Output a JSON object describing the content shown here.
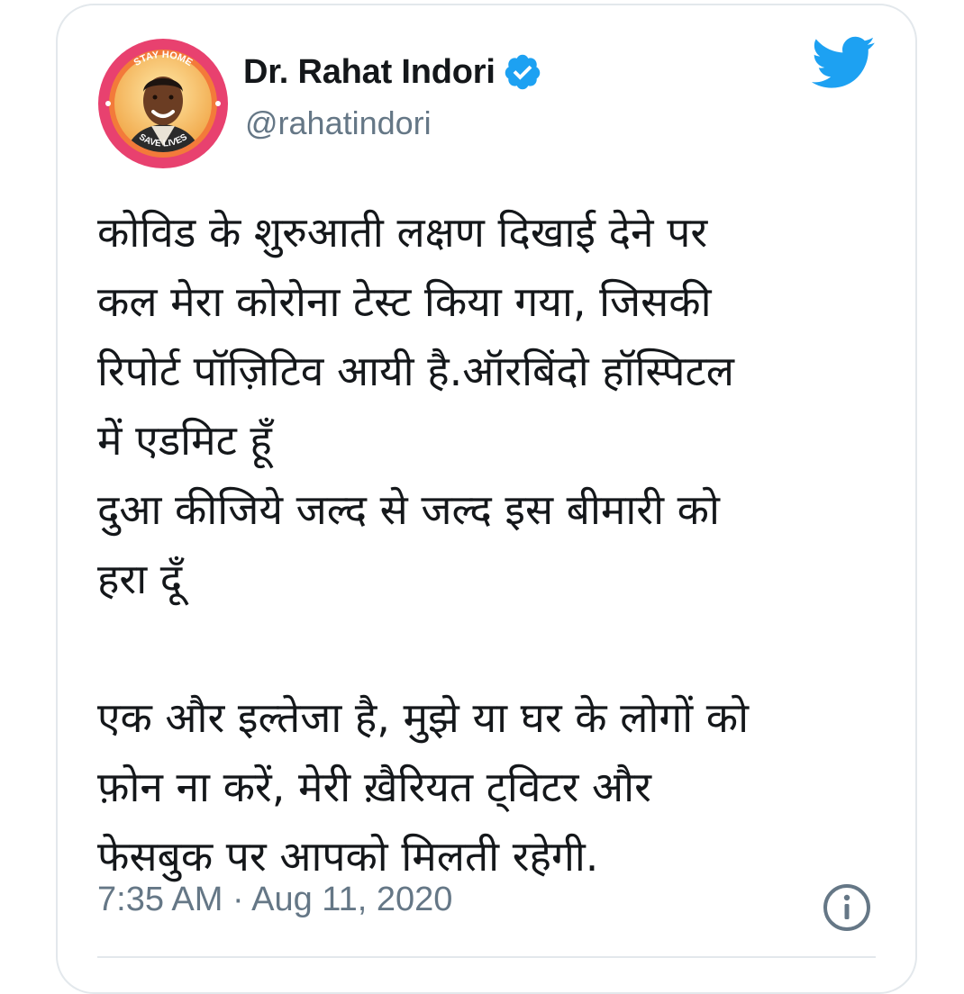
{
  "author": {
    "name": "Dr. Rahat Indori",
    "handle": "@rahatindori",
    "avatar_badge_top": "STAY HOME",
    "avatar_badge_bottom": "SAVE LIVES",
    "verified": true
  },
  "tweet": {
    "lines": [
      "कोविड के शुरुआती लक्षण दिखाई देने पर",
      "कल मेरा कोरोना टेस्ट किया गया, जिसकी",
      "रिपोर्ट पॉज़िटिव आयी है.ऑरबिंदो हॉस्पिटल",
      "में एडमिट हूँ",
      "दुआ कीजिये जल्द से जल्द इस बीमारी को",
      "हरा दूँ",
      "",
      "एक और इल्तेजा है, मुझे या घर के लोगों को",
      "फ़ोन ना करें, मेरी ख़ैरियत ट्विटर और",
      "फेसबुक पर आपको मिलती रहेगी."
    ],
    "timestamp": "7:35 AM · Aug 11, 2020"
  },
  "icons": {
    "verified": "verified-badge-icon",
    "brand": "twitter-bird-icon",
    "info": "info-icon"
  },
  "colors": {
    "twitter_blue": "#1da1f2",
    "text_primary": "#14171a",
    "text_secondary": "#657786",
    "avatar_ring": "#e8416f",
    "avatar_bg": "#ffdd88"
  }
}
